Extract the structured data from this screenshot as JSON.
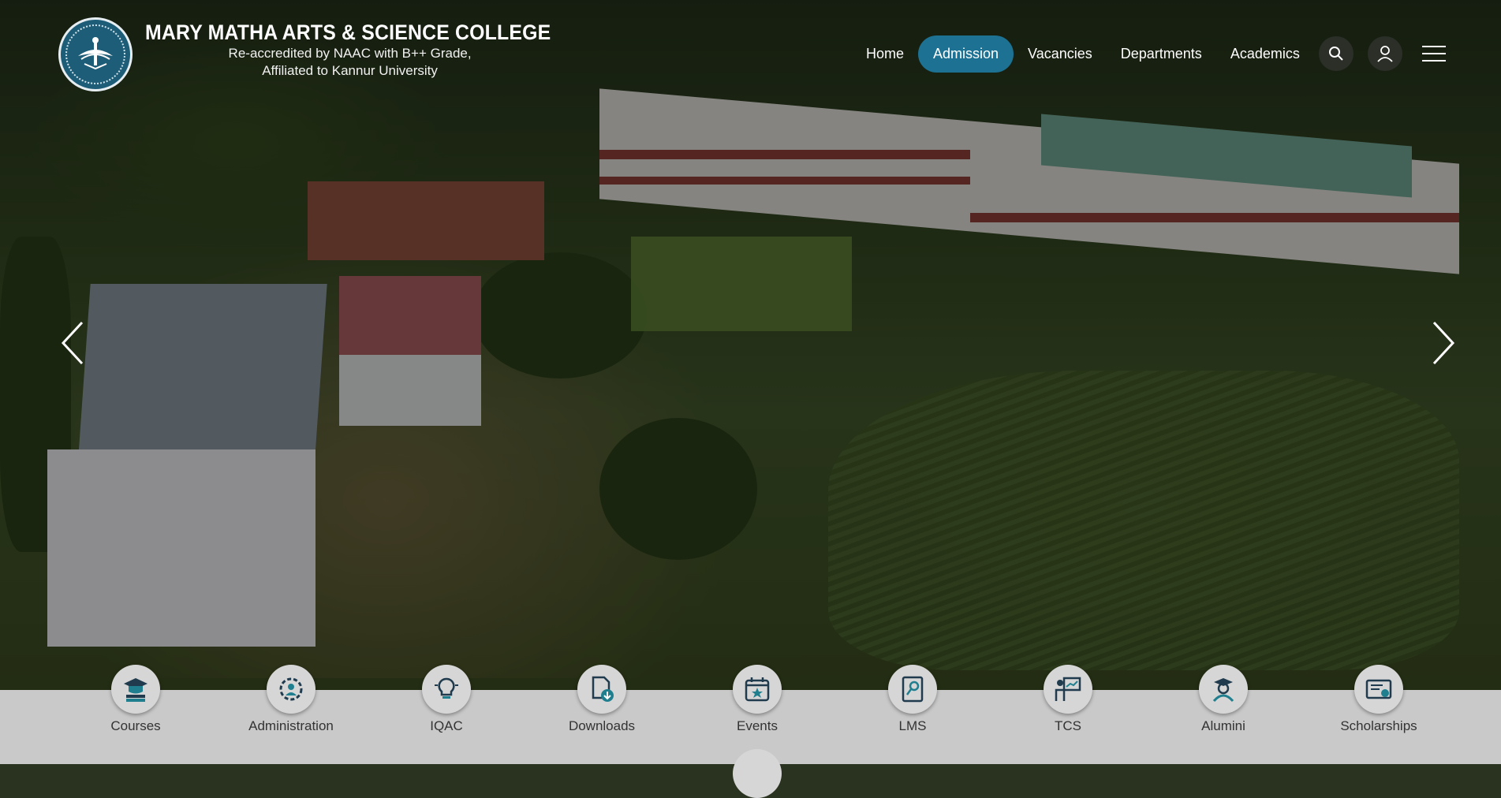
{
  "brand": {
    "name": "MARY MATHA ARTS & SCIENCE COLLEGE",
    "line1": "Re-accredited by NAAC with B++ Grade,",
    "line2": "Affiliated to Kannur University"
  },
  "nav": {
    "items": [
      {
        "label": "Home",
        "active": false
      },
      {
        "label": "Admission",
        "active": true
      },
      {
        "label": "Vacancies",
        "active": false
      },
      {
        "label": "Departments",
        "active": false
      },
      {
        "label": "Academics",
        "active": false
      }
    ],
    "icons": [
      "search-icon",
      "user-icon",
      "menu-icon"
    ]
  },
  "carousel": {
    "prev_icon": "chevron-left-icon",
    "next_icon": "chevron-right-icon"
  },
  "quicklinks": [
    {
      "label": "Courses",
      "icon": "courses-icon"
    },
    {
      "label": "Administration",
      "icon": "administration-icon"
    },
    {
      "label": "IQAC",
      "icon": "iqac-icon"
    },
    {
      "label": "Downloads",
      "icon": "downloads-icon"
    },
    {
      "label": "Events",
      "icon": "events-icon"
    },
    {
      "label": "LMS",
      "icon": "lms-icon"
    },
    {
      "label": "TCS",
      "icon": "tcs-icon"
    },
    {
      "label": "Alumini",
      "icon": "alumni-icon"
    },
    {
      "label": "Scholarships",
      "icon": "scholarships-icon"
    }
  ],
  "colors": {
    "accent": "#1d7294",
    "icon_dark": "#1f3b4d",
    "icon_teal": "#1f7f8f",
    "quickbar_bg": "#c9c9c9"
  }
}
